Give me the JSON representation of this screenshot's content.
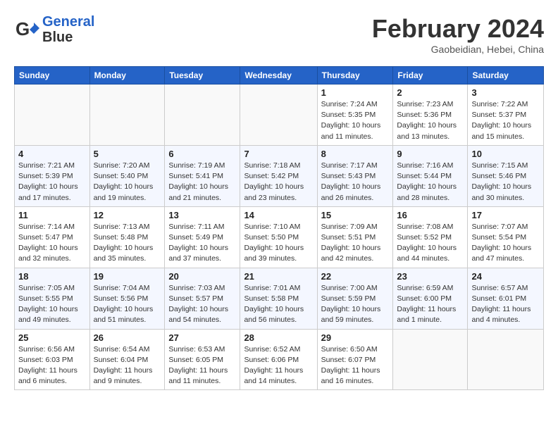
{
  "header": {
    "logo_line1": "General",
    "logo_line2": "Blue",
    "month_title": "February 2024",
    "location": "Gaobeidian, Hebei, China"
  },
  "days_of_week": [
    "Sunday",
    "Monday",
    "Tuesday",
    "Wednesday",
    "Thursday",
    "Friday",
    "Saturday"
  ],
  "weeks": [
    [
      {
        "date": "",
        "info": ""
      },
      {
        "date": "",
        "info": ""
      },
      {
        "date": "",
        "info": ""
      },
      {
        "date": "",
        "info": ""
      },
      {
        "date": "1",
        "info": "Sunrise: 7:24 AM\nSunset: 5:35 PM\nDaylight: 10 hours\nand 11 minutes."
      },
      {
        "date": "2",
        "info": "Sunrise: 7:23 AM\nSunset: 5:36 PM\nDaylight: 10 hours\nand 13 minutes."
      },
      {
        "date": "3",
        "info": "Sunrise: 7:22 AM\nSunset: 5:37 PM\nDaylight: 10 hours\nand 15 minutes."
      }
    ],
    [
      {
        "date": "4",
        "info": "Sunrise: 7:21 AM\nSunset: 5:39 PM\nDaylight: 10 hours\nand 17 minutes."
      },
      {
        "date": "5",
        "info": "Sunrise: 7:20 AM\nSunset: 5:40 PM\nDaylight: 10 hours\nand 19 minutes."
      },
      {
        "date": "6",
        "info": "Sunrise: 7:19 AM\nSunset: 5:41 PM\nDaylight: 10 hours\nand 21 minutes."
      },
      {
        "date": "7",
        "info": "Sunrise: 7:18 AM\nSunset: 5:42 PM\nDaylight: 10 hours\nand 23 minutes."
      },
      {
        "date": "8",
        "info": "Sunrise: 7:17 AM\nSunset: 5:43 PM\nDaylight: 10 hours\nand 26 minutes."
      },
      {
        "date": "9",
        "info": "Sunrise: 7:16 AM\nSunset: 5:44 PM\nDaylight: 10 hours\nand 28 minutes."
      },
      {
        "date": "10",
        "info": "Sunrise: 7:15 AM\nSunset: 5:46 PM\nDaylight: 10 hours\nand 30 minutes."
      }
    ],
    [
      {
        "date": "11",
        "info": "Sunrise: 7:14 AM\nSunset: 5:47 PM\nDaylight: 10 hours\nand 32 minutes."
      },
      {
        "date": "12",
        "info": "Sunrise: 7:13 AM\nSunset: 5:48 PM\nDaylight: 10 hours\nand 35 minutes."
      },
      {
        "date": "13",
        "info": "Sunrise: 7:11 AM\nSunset: 5:49 PM\nDaylight: 10 hours\nand 37 minutes."
      },
      {
        "date": "14",
        "info": "Sunrise: 7:10 AM\nSunset: 5:50 PM\nDaylight: 10 hours\nand 39 minutes."
      },
      {
        "date": "15",
        "info": "Sunrise: 7:09 AM\nSunset: 5:51 PM\nDaylight: 10 hours\nand 42 minutes."
      },
      {
        "date": "16",
        "info": "Sunrise: 7:08 AM\nSunset: 5:52 PM\nDaylight: 10 hours\nand 44 minutes."
      },
      {
        "date": "17",
        "info": "Sunrise: 7:07 AM\nSunset: 5:54 PM\nDaylight: 10 hours\nand 47 minutes."
      }
    ],
    [
      {
        "date": "18",
        "info": "Sunrise: 7:05 AM\nSunset: 5:55 PM\nDaylight: 10 hours\nand 49 minutes."
      },
      {
        "date": "19",
        "info": "Sunrise: 7:04 AM\nSunset: 5:56 PM\nDaylight: 10 hours\nand 51 minutes."
      },
      {
        "date": "20",
        "info": "Sunrise: 7:03 AM\nSunset: 5:57 PM\nDaylight: 10 hours\nand 54 minutes."
      },
      {
        "date": "21",
        "info": "Sunrise: 7:01 AM\nSunset: 5:58 PM\nDaylight: 10 hours\nand 56 minutes."
      },
      {
        "date": "22",
        "info": "Sunrise: 7:00 AM\nSunset: 5:59 PM\nDaylight: 10 hours\nand 59 minutes."
      },
      {
        "date": "23",
        "info": "Sunrise: 6:59 AM\nSunset: 6:00 PM\nDaylight: 11 hours\nand 1 minute."
      },
      {
        "date": "24",
        "info": "Sunrise: 6:57 AM\nSunset: 6:01 PM\nDaylight: 11 hours\nand 4 minutes."
      }
    ],
    [
      {
        "date": "25",
        "info": "Sunrise: 6:56 AM\nSunset: 6:03 PM\nDaylight: 11 hours\nand 6 minutes."
      },
      {
        "date": "26",
        "info": "Sunrise: 6:54 AM\nSunset: 6:04 PM\nDaylight: 11 hours\nand 9 minutes."
      },
      {
        "date": "27",
        "info": "Sunrise: 6:53 AM\nSunset: 6:05 PM\nDaylight: 11 hours\nand 11 minutes."
      },
      {
        "date": "28",
        "info": "Sunrise: 6:52 AM\nSunset: 6:06 PM\nDaylight: 11 hours\nand 14 minutes."
      },
      {
        "date": "29",
        "info": "Sunrise: 6:50 AM\nSunset: 6:07 PM\nDaylight: 11 hours\nand 16 minutes."
      },
      {
        "date": "",
        "info": ""
      },
      {
        "date": "",
        "info": ""
      }
    ]
  ]
}
